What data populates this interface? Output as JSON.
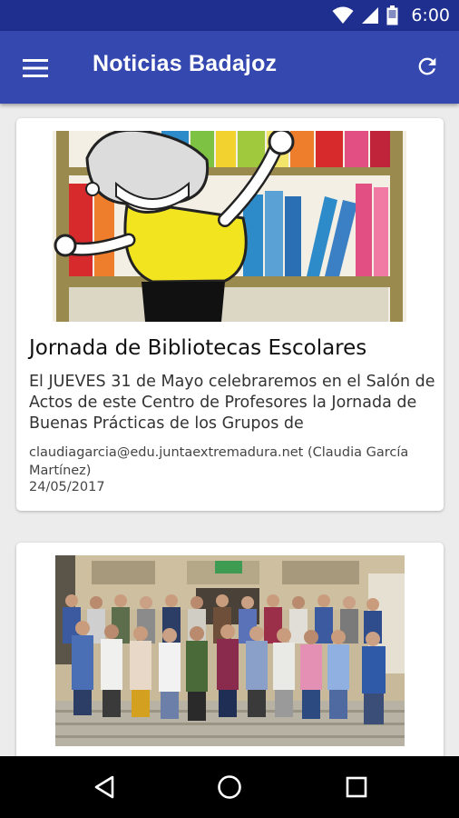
{
  "status_bar": {
    "time": "6:00",
    "icons": [
      "wifi-icon",
      "cell-signal-icon",
      "battery-icon"
    ]
  },
  "app_bar": {
    "title": "Noticias Badajoz",
    "menu_icon": "hamburger-menu-icon",
    "refresh_icon": "refresh-icon",
    "background": "#3448b0",
    "status_background": "#1e2f8f"
  },
  "news": [
    {
      "image": "cartoon-library-illustration",
      "title": "Jornada de Bibliotecas Escolares",
      "summary": "El   JUEVES 31 de Mayo celebraremos en el Salón de Actos de este Centro de Profesores la Jornada de Buenas Prácticas de los Grupos de",
      "author": "claudiagarcia@edu.juntaextremadura.net (Claudia García Martínez)",
      "date": "24/05/2017"
    },
    {
      "image": "group-photo-on-stairs"
    }
  ],
  "nav_bar": {
    "icons": [
      "back-icon",
      "home-icon",
      "recent-apps-icon"
    ]
  }
}
